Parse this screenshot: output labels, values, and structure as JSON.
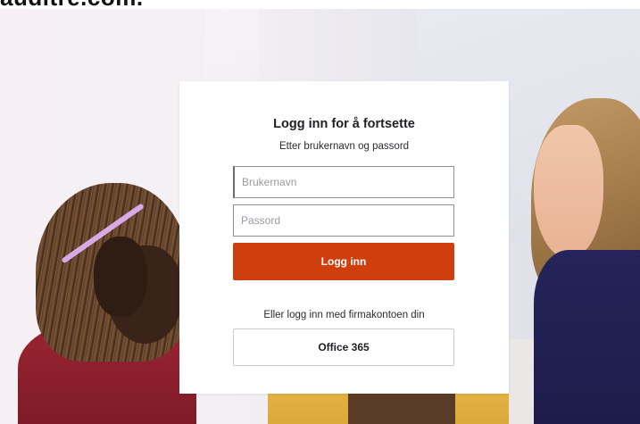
{
  "header": {
    "brand_text": "auditre.com."
  },
  "login": {
    "title": "Logg inn for å fortsette",
    "subtitle": "Etter brukernavn og passord",
    "username": {
      "placeholder": "Brukernavn",
      "value": ""
    },
    "password": {
      "placeholder": "Passord",
      "value": ""
    },
    "submit_label": "Logg inn",
    "alt_login_text": "Eller logg inn med firmakontoen din",
    "office_label": "Office 365"
  },
  "colors": {
    "primary_button": "#cf3f0d",
    "card_background": "#ffffff",
    "text": "#1f1f24"
  }
}
